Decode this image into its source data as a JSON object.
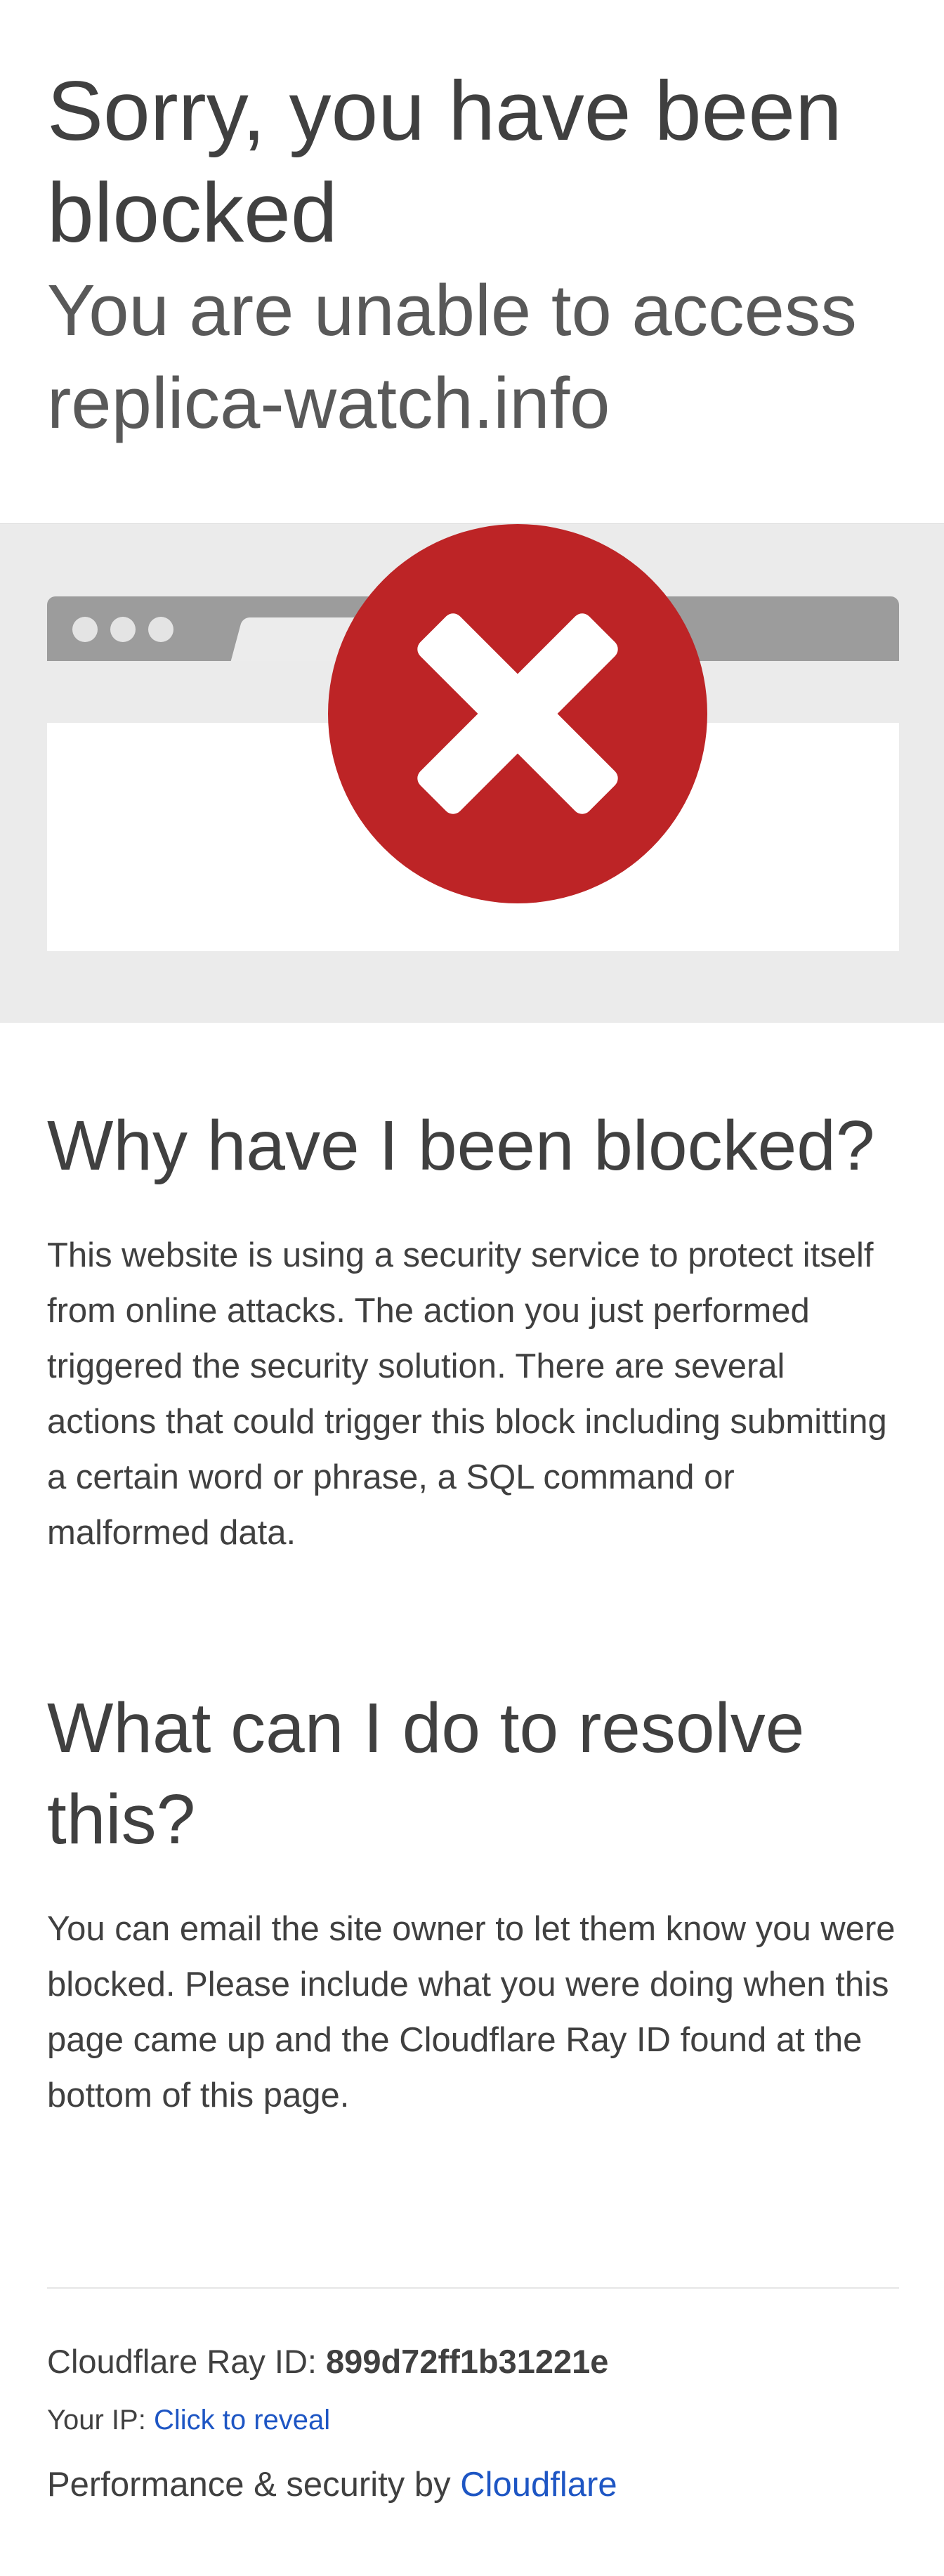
{
  "header": {
    "title": "Sorry, you have been blocked",
    "subtitle_line1": "You are unable to access",
    "subtitle_line2": "replica-watch.info"
  },
  "banner": {
    "icon": "blocked-x-icon",
    "colors": {
      "circle": "#bd2426",
      "browser_bar": "#9c9c9c",
      "background": "#ebebeb"
    }
  },
  "why": {
    "heading": "Why have I been blocked?",
    "body": "This website is using a security service to protect itself from online attacks. The action you just performed triggered the security solution. There are several actions that could trigger this block including submitting a certain word or phrase, a SQL command or malformed data."
  },
  "what": {
    "heading": "What can I do to resolve this?",
    "body": "You can email the site owner to let them know you were blocked. Please include what you were doing when this page came up and the Cloudflare Ray ID found at the bottom of this page."
  },
  "footer": {
    "ray_label": "Cloudflare Ray ID: ",
    "ray_id": "899d72ff1b31221e",
    "ip_label": "Your IP: ",
    "ip_reveal": "Click to reveal",
    "perf_label": "Performance & security by ",
    "perf_link": "Cloudflare",
    "link_color": "#1e56c4"
  }
}
